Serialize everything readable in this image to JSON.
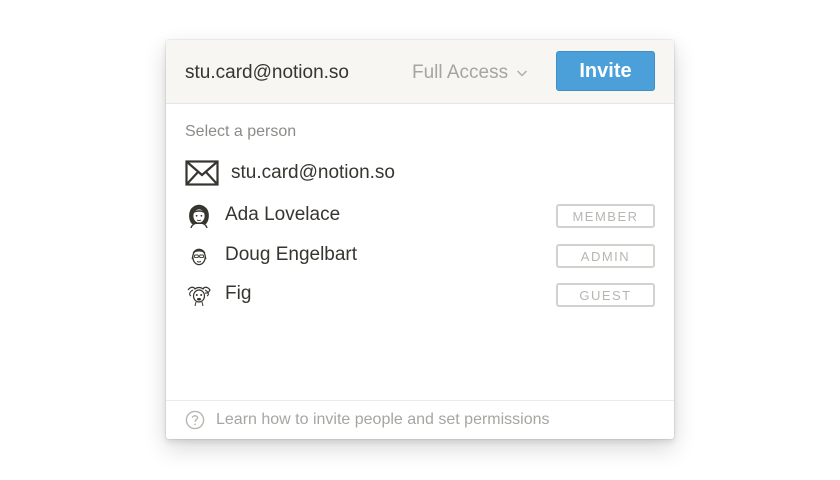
{
  "invite_dialog": {
    "input_value": "stu.card@notion.so",
    "access_level": "Full Access",
    "invite_label": "Invite",
    "section_label": "Select a person",
    "email_suggestion": {
      "email": "stu.card@notion.so",
      "icon": "mail-icon"
    },
    "people": [
      {
        "name": "Ada Lovelace",
        "role": "MEMBER",
        "avatar": "ada-avatar-icon"
      },
      {
        "name": "Doug Engelbart",
        "role": "ADMIN",
        "avatar": "doug-avatar-icon"
      },
      {
        "name": "Fig",
        "role": "GUEST",
        "avatar": "fig-avatar-icon"
      }
    ],
    "help_text": "Learn how to invite people and set permissions",
    "colors": {
      "invite_button": "#4ba0d9",
      "header_bg": "#f7f6f3",
      "text": "#37352f",
      "muted_text": "#a6a5a1"
    }
  }
}
